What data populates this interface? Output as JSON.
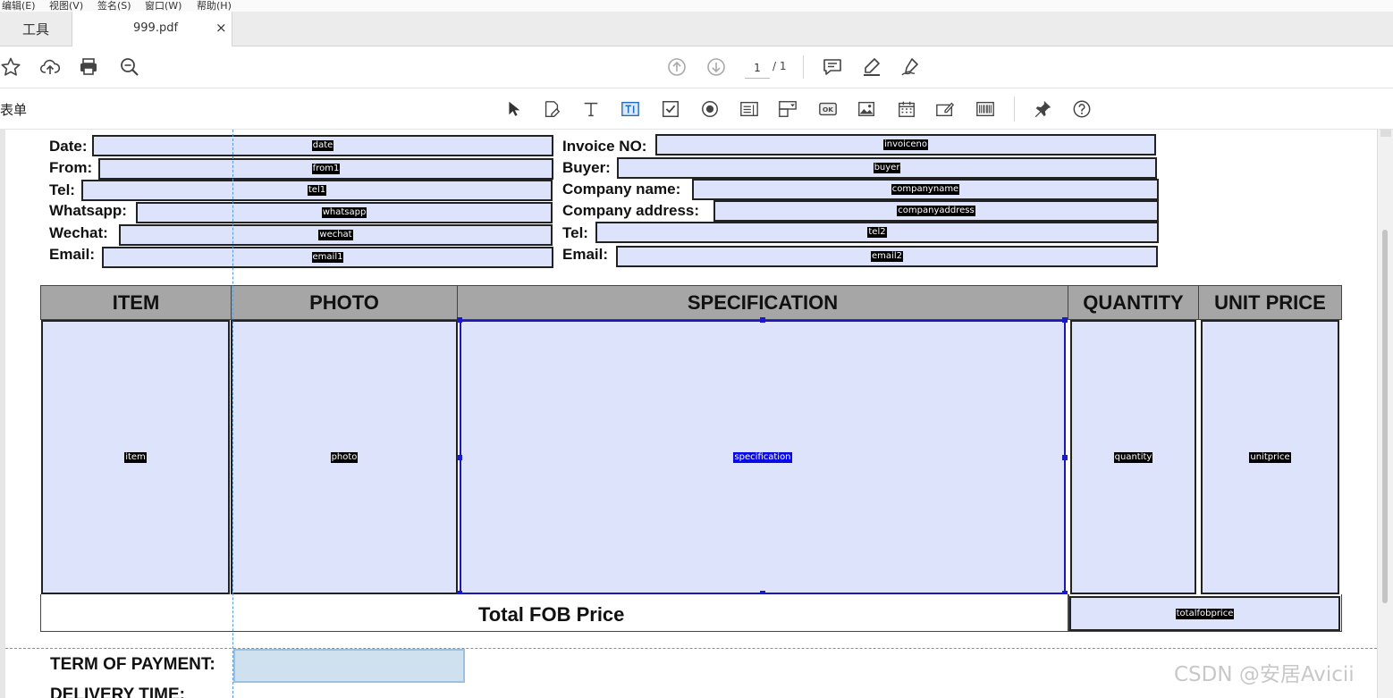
{
  "menubar": {
    "items": [
      "编辑(E)",
      "视图(V)",
      "签名(S)",
      "窗口(W)",
      "帮助(H)"
    ]
  },
  "tabs": {
    "tools_label": "工具",
    "document_label": "999.pdf",
    "close_glyph": "×"
  },
  "toolbar": {
    "icons": [
      "star-icon",
      "cloud-upload-icon",
      "print-icon",
      "zoom-search-icon",
      "page-up-icon",
      "page-down-icon",
      "comment-icon",
      "highlight-pen-icon",
      "sign-pen-icon"
    ],
    "page_current": "1",
    "page_total": "/ 1"
  },
  "formbar": {
    "title": "表单",
    "icons": [
      "select-arrow-icon",
      "edit-form-icon",
      "text-icon",
      "text-field-icon",
      "checkbox-icon",
      "radio-button-icon",
      "list-box-icon",
      "dropdown-icon",
      "button-ok-icon",
      "image-icon",
      "date-field-icon",
      "signature-field-icon",
      "barcode-icon",
      "pin-icon",
      "help-icon"
    ]
  },
  "form": {
    "left": [
      {
        "label": "Date:",
        "field": "date"
      },
      {
        "label": "From:",
        "field": "from1"
      },
      {
        "label": "Tel:",
        "field": "tel1"
      },
      {
        "label": "Whatsapp:",
        "field": "whatsapp"
      },
      {
        "label": "Wechat:",
        "field": "wechat"
      },
      {
        "label": "Email:",
        "field": "email1"
      }
    ],
    "right": [
      {
        "label": "Invoice NO:",
        "field": "invoiceno"
      },
      {
        "label": "Buyer:",
        "field": "buyer"
      },
      {
        "label": "Company name:",
        "field": "companyname"
      },
      {
        "label": "Company address:",
        "field": "companyaddress"
      },
      {
        "label": "Tel:",
        "field": "tel2"
      },
      {
        "label": "Email:",
        "field": "email2"
      }
    ],
    "table": {
      "headers": [
        "ITEM",
        "PHOTO",
        "SPECIFICATION",
        "QUANTITY",
        "UNIT PRICE"
      ],
      "fields": [
        "item",
        "photo",
        "specification",
        "quantity",
        "unitprice"
      ],
      "selected_field": "specification"
    },
    "total": {
      "label": "Total FOB Price",
      "field": "totalfobprice"
    },
    "term_label": "TERM OF PAYMENT:",
    "delivery_label": "DELIVERY TIME:"
  },
  "watermark": "CSDN @安居Avicii",
  "colors": {
    "field_fill": "#dde3fb",
    "header_fill": "#a6a6a6",
    "selection": "#1a1acc",
    "guide": "#5b9bd5"
  }
}
